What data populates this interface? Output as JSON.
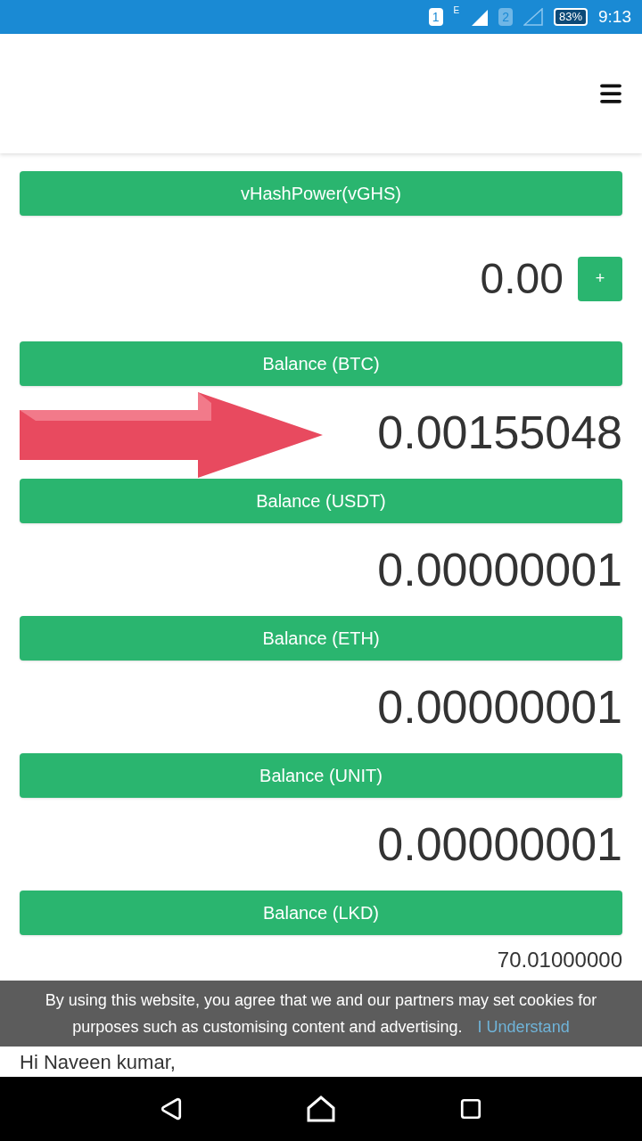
{
  "status_bar": {
    "sim1": "1",
    "network": "E",
    "sim2": "2",
    "battery": "83%",
    "time": "9:13"
  },
  "sections": [
    {
      "label": "vHashPower(vGHS)",
      "value": "0.00",
      "kind": "add",
      "action": "+"
    },
    {
      "label": "Balance (BTC)",
      "value": "0.00155048",
      "kind": "large"
    },
    {
      "label": "Balance (USDT)",
      "value": "0.00000001",
      "kind": "large"
    },
    {
      "label": "Balance (ETH)",
      "value": "0.00000001",
      "kind": "large"
    },
    {
      "label": "Balance (UNIT)",
      "value": "0.00000001",
      "kind": "large"
    },
    {
      "label": "Balance (LKD)",
      "value": "70.01000000",
      "kind": "small"
    }
  ],
  "greeting": "Hi Naveen kumar,",
  "cookie_banner": {
    "message": "By using this website, you agree that we and our partners may set cookies for purposes such as customising content and advertising.",
    "link": "I Understand"
  }
}
